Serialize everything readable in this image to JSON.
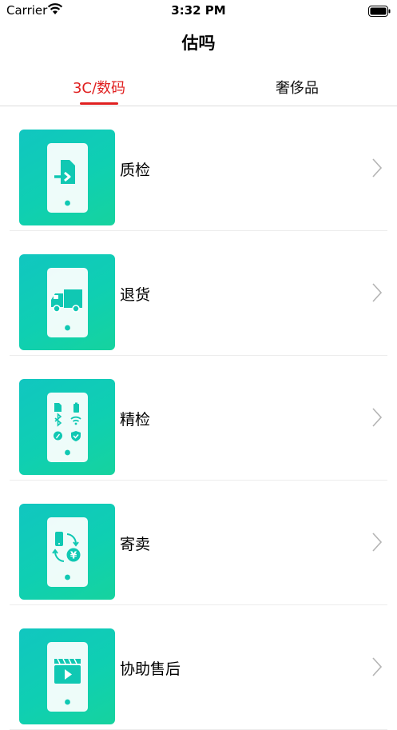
{
  "status_bar": {
    "carrier": "Carrier",
    "time": "3:32 PM"
  },
  "nav": {
    "title": "估吗"
  },
  "tabs": [
    {
      "label": "3C/数码",
      "active": true
    },
    {
      "label": "奢侈品",
      "active": false
    }
  ],
  "items": [
    {
      "label": "质检",
      "icon": "phone-sim-arrow-icon"
    },
    {
      "label": "退货",
      "icon": "phone-truck-icon"
    },
    {
      "label": "精检",
      "icon": "phone-grid-icons-icon"
    },
    {
      "label": "寄卖",
      "icon": "phone-exchange-yuan-icon"
    },
    {
      "label": "协助售后",
      "icon": "phone-video-icon"
    }
  ],
  "colors": {
    "accent": "#e02020",
    "tile_start": "#11c6c0",
    "tile_end": "#16d39e"
  }
}
